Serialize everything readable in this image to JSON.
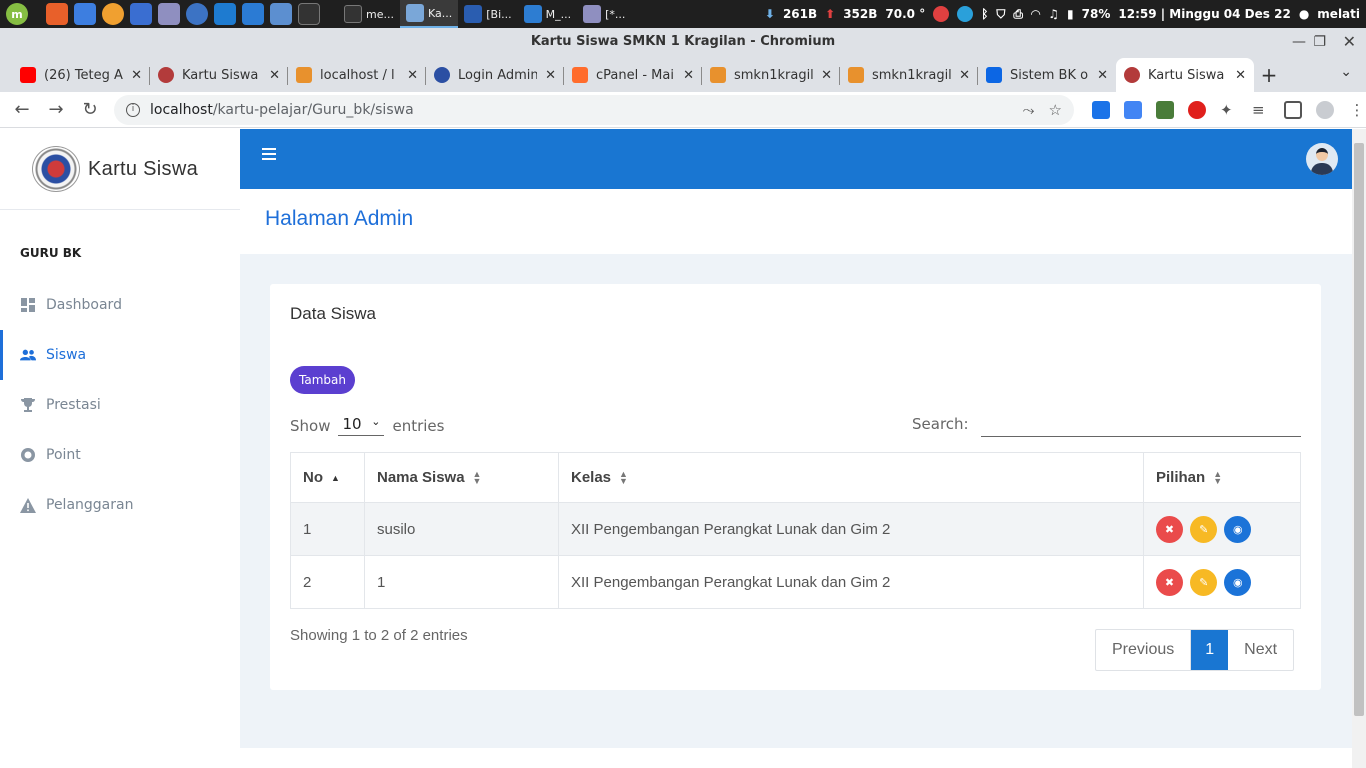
{
  "taskbar": {
    "windows": [
      {
        "label": "me...",
        "color": "#333333"
      },
      {
        "label": "Ka...",
        "color": "#7aa7d8",
        "active": true
      },
      {
        "label": "[Bi...",
        "color": "#2a5db0"
      },
      {
        "label": "M_...",
        "color": "#2d7dd2"
      },
      {
        "label": "[*...",
        "color": "#8f8fc0"
      }
    ],
    "net_down": "261B",
    "net_up": "352B",
    "temp": "70.0 °",
    "battery": "78%",
    "clock": "12:59 | Minggu 04 Des 22",
    "user": "melati"
  },
  "window": {
    "title": "Kartu Siswa SMKN 1 Kragilan - Chromium"
  },
  "tabs": [
    {
      "title": "(26) Teteg A",
      "fav_color": "#ff0000"
    },
    {
      "title": "Kartu Siswa",
      "fav_color": "#b33b3b"
    },
    {
      "title": "localhost / l",
      "fav_color": "#e8912d"
    },
    {
      "title": "Login Admin",
      "fav_color": "#2b4fa3"
    },
    {
      "title": "cPanel - Mai",
      "fav_color": "#ff6c2c"
    },
    {
      "title": "smkn1kragil",
      "fav_color": "#e8912d"
    },
    {
      "title": "smkn1kragil",
      "fav_color": "#e8912d"
    },
    {
      "title": "Sistem BK or",
      "fav_color": "#0c66e4"
    },
    {
      "title": "Kartu Siswa",
      "fav_color": "#b33b3b",
      "active": true
    }
  ],
  "address": {
    "host": "localhost",
    "path": "/kartu-pelajar/Guru_bk/siswa"
  },
  "sidebar": {
    "brand": "Kartu Siswa",
    "section": "GURU BK",
    "items": [
      {
        "label": "Dashboard",
        "icon": "dashboard-icon"
      },
      {
        "label": "Siswa",
        "icon": "users-icon",
        "active": true
      },
      {
        "label": "Prestasi",
        "icon": "trophy-icon"
      },
      {
        "label": "Point",
        "icon": "circle-icon"
      },
      {
        "label": "Pelanggaran",
        "icon": "warning-icon"
      }
    ]
  },
  "header": {
    "page_title": "Halaman Admin"
  },
  "card": {
    "title": "Data Siswa",
    "add_button": "Tambah",
    "show_label": "Show",
    "show_value": "10",
    "entries_label": "entries",
    "search_label": "Search:",
    "search_value": "",
    "columns": [
      "No",
      "Nama Siswa",
      "Kelas",
      "Pilihan"
    ],
    "rows": [
      {
        "no": "1",
        "nama": "susilo",
        "kelas": "XII Pengembangan Perangkat Lunak dan Gim 2"
      },
      {
        "no": "2",
        "nama": "1",
        "kelas": "XII Pengembangan Perangkat Lunak dan Gim 2"
      }
    ],
    "info": "Showing 1 to 2 of 2 entries",
    "pager": {
      "prev": "Previous",
      "current": "1",
      "next": "Next"
    }
  },
  "colors": {
    "primary": "#1976d2",
    "add_button": "#5b3fd0",
    "delete": "#ea4b4b",
    "edit": "#f7b924",
    "view": "#1b73d8"
  }
}
